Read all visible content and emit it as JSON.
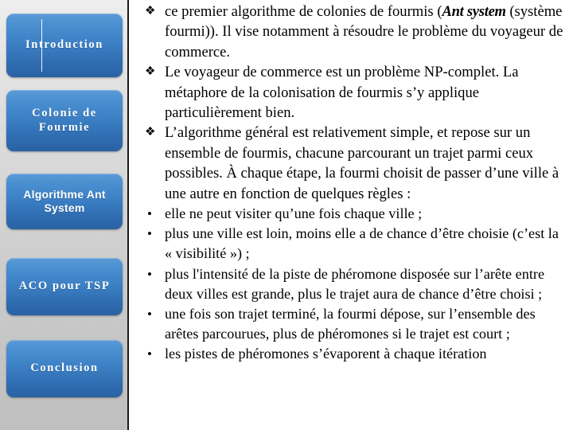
{
  "slide": {
    "theme_accent": "#3c7fc4",
    "sidebar_bg": "#d5d5d5",
    "text_color": "#000000"
  },
  "sidebar": {
    "items": [
      {
        "label": "Introduction",
        "style": "serif",
        "name": "sidebar-item-introduction"
      },
      {
        "label": "Colonie de Fourmie",
        "style": "serif",
        "name": "sidebar-item-colonie-de-fourmie"
      },
      {
        "label": "Algorithme Ant System",
        "style": "sans",
        "name": "sidebar-item-algorithme-ant-system"
      },
      {
        "label": "ACO pour TSP",
        "style": "serif",
        "name": "sidebar-item-aco-pour-tsp"
      },
      {
        "label": "Conclusion",
        "style": "serif",
        "name": "sidebar-item-conclusion"
      }
    ]
  },
  "content": {
    "bullets": [
      {
        "level": 1,
        "marker": "diamond-bullet-icon",
        "glyph": "❖",
        "text_before": "ce premier algorithme de colonies de fourmis (",
        "emphasis": "Ant system",
        "text_after": " (système fourmi)). Il vise notamment à résoudre le problème du voyageur de commerce."
      },
      {
        "level": 1,
        "marker": "diamond-bullet-icon",
        "glyph": "❖",
        "text": "Le voyageur de commerce est un problème NP-complet. La métaphore de la colonisation de fourmis s’y applique particulièrement bien."
      },
      {
        "level": 1,
        "marker": "diamond-bullet-icon",
        "glyph": "❖",
        "text": "L’algorithme général est relativement simple, et repose sur un ensemble de fourmis, chacune parcourant un trajet parmi ceux possibles. À chaque étape, la fourmi choisit de passer d’une ville à une autre en fonction de quelques règles :"
      },
      {
        "level": 2,
        "marker": "round-bullet-icon",
        "glyph": "•",
        "text": "elle ne peut visiter qu’une fois chaque ville ;"
      },
      {
        "level": 2,
        "marker": "round-bullet-icon",
        "glyph": "•",
        "text": "plus une ville est loin, moins elle a de chance d’être choisie (c’est la « visibilité ») ;"
      },
      {
        "level": 2,
        "marker": "round-bullet-icon",
        "glyph": "•",
        "text": "plus l'intensité de la piste de phéromone disposée sur l’arête entre deux villes est grande, plus le trajet aura de chance d’être choisi ;"
      },
      {
        "level": 2,
        "marker": "round-bullet-icon",
        "glyph": "•",
        "text": "une fois son trajet terminé, la fourmi dépose, sur l’ensemble des arêtes parcourues, plus de phéromones si le trajet est court ;"
      },
      {
        "level": 2,
        "marker": "round-bullet-icon",
        "glyph": "•",
        "text": "les pistes de phéromones s’évaporent à chaque itération"
      }
    ]
  }
}
